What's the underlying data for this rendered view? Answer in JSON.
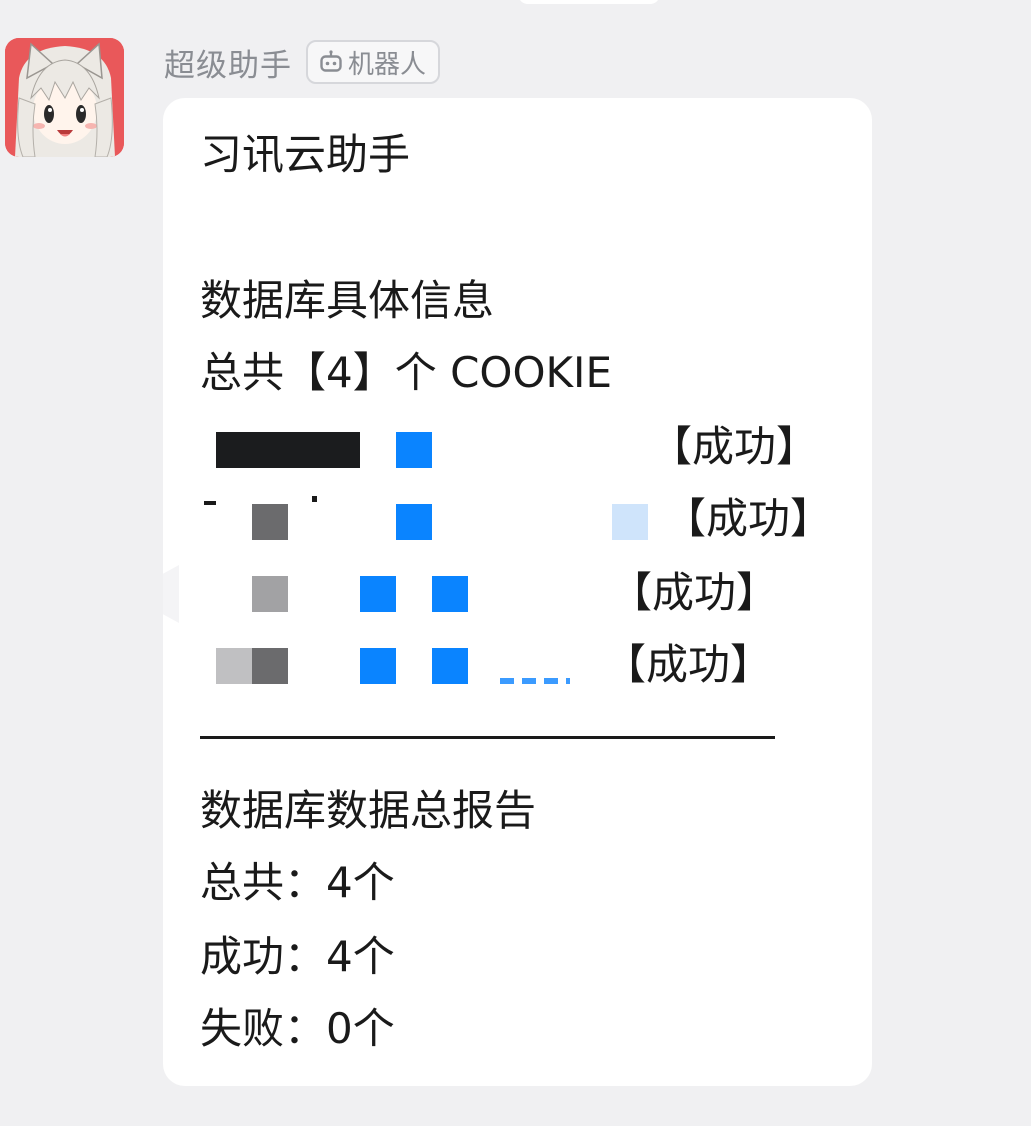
{
  "sender": {
    "name": "超级助手",
    "badge_label": "机器人",
    "avatar_icon": "anime-cat-girl-avatar",
    "badge_icon": "robot-icon"
  },
  "message": {
    "title": "习讯云助手",
    "section1_heading": "数据库具体信息",
    "cookie_total_line": "总共【4】个 COOKIE",
    "entries": [
      {
        "status": "【成功】"
      },
      {
        "status": "【成功】"
      },
      {
        "status": "【成功】"
      },
      {
        "status": "【成功】"
      }
    ],
    "report_heading": "数据库数据总报告",
    "summary": {
      "total": "总共：4个",
      "success": "成功：4个",
      "failed": "失败：0个"
    }
  },
  "colors": {
    "background": "#f0f0f2",
    "bubble": "#ffffff",
    "redaction_blue": "#0a84ff",
    "sender_gray": "#8a8d93"
  }
}
